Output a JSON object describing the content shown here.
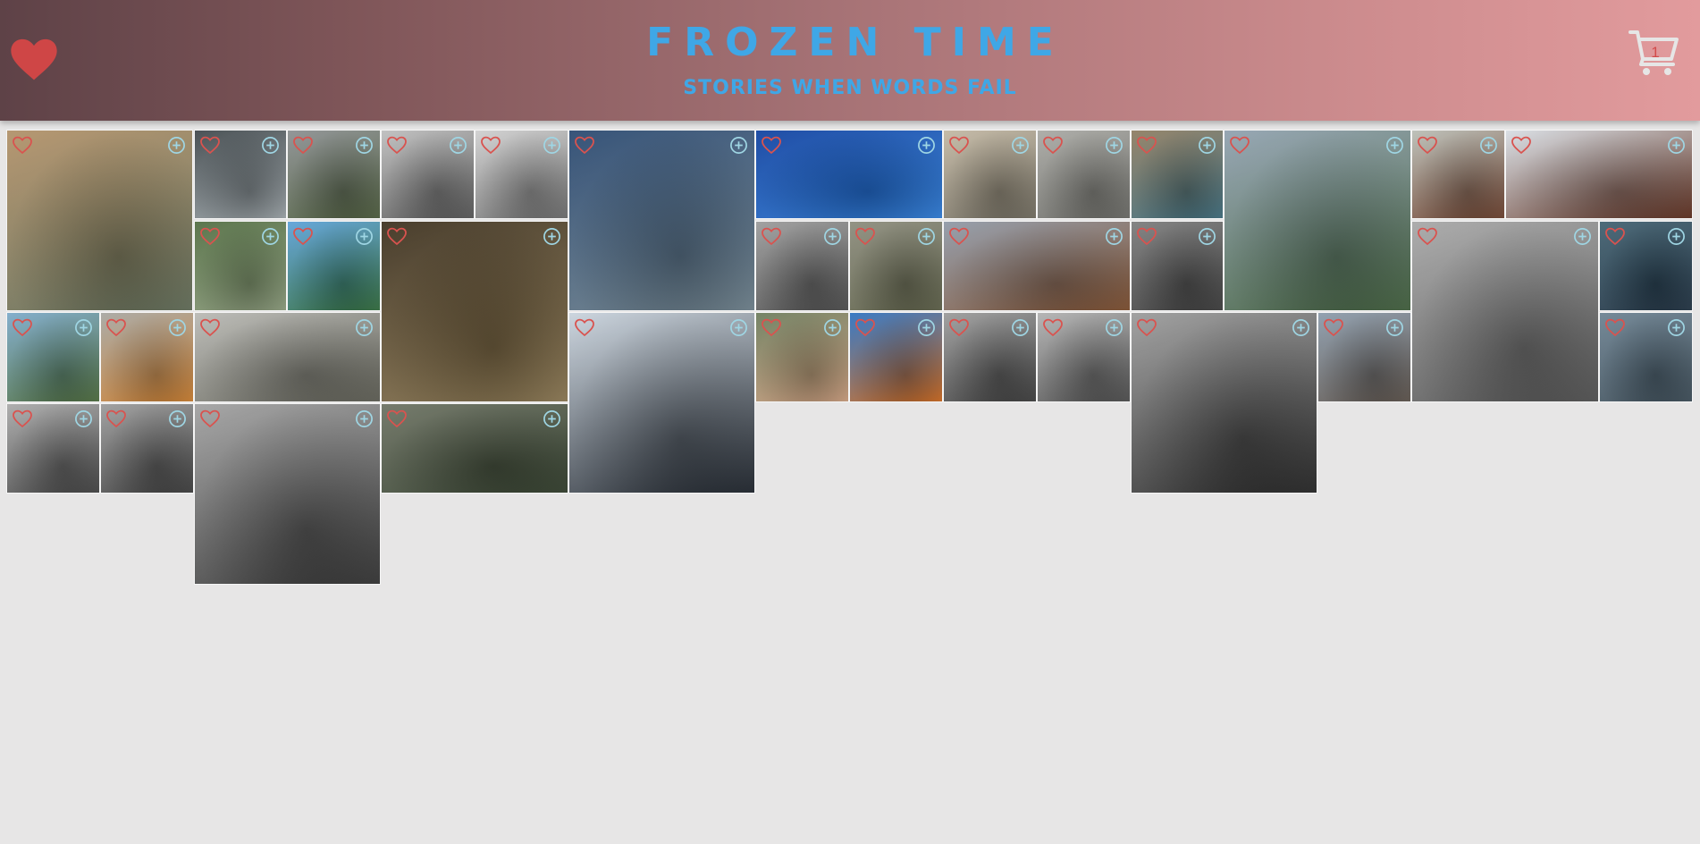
{
  "header": {
    "title": "FROZEN TIME",
    "subtitle": "STORIES WHEN WORDS FAIL",
    "cart_count": "1"
  },
  "colors": {
    "title_blue": "#3fa7e6",
    "heart_red": "#d9534f",
    "add_icon": "#9fd6e4",
    "page_background": "#e7e6e6"
  },
  "icons": {
    "logo": "heart-icon",
    "cart": "shopping-cart-icon",
    "favorite": "heart-outline-icon",
    "add": "plus-circle-icon"
  },
  "photos": [
    {
      "name": "photo-ponte-vecchio",
      "c1": "#b08f66",
      "c2": "#5e6a55"
    },
    {
      "name": "photo-stormy-mountains",
      "c1": "#3c4448",
      "c2": "#9aa2a6"
    },
    {
      "name": "photo-valley-clouds",
      "c1": "#8a8e90",
      "c2": "#4a5a3a"
    },
    {
      "name": "photo-snowy-trees-bw",
      "c1": "#bdbdbd",
      "c2": "#555555"
    },
    {
      "name": "photo-white-horse",
      "c1": "#cfcfcf",
      "c2": "#6b6b6b"
    },
    {
      "name": "photo-blue-house-dam",
      "c1": "#27466e",
      "c2": "#6c7f8a"
    },
    {
      "name": "photo-mountain-lake",
      "c1": "#0d3f9e",
      "c2": "#2b79d4"
    },
    {
      "name": "photo-kids-door",
      "c1": "#c2b7a2",
      "c2": "#6f6a5d"
    },
    {
      "name": "photo-stone-steps",
      "c1": "#a8a8a3",
      "c2": "#686863"
    },
    {
      "name": "photo-rainy-street",
      "c1": "#8d7b5f",
      "c2": "#3b6a7a"
    },
    {
      "name": "photo-cliff-peaks",
      "c1": "#8fa0ae",
      "c2": "#3e5d3a"
    },
    {
      "name": "photo-bird-gliding",
      "c1": "#b9bdb5",
      "c2": "#6a3d2a"
    },
    {
      "name": "photo-red-kite",
      "c1": "#d7dde3",
      "c2": "#5a2a1a"
    },
    {
      "name": "photo-overgrown-car",
      "c1": "#4f6b3f",
      "c2": "#8a9a7a"
    },
    {
      "name": "photo-green-hills",
      "c1": "#5aa0d8",
      "c2": "#2e6a3a"
    },
    {
      "name": "photo-catacomb-skulls",
      "c1": "#3a2e1c",
      "c2": "#8a7650"
    },
    {
      "name": "photo-boat-bw",
      "c1": "#9a9a9a",
      "c2": "#4a4a4a"
    },
    {
      "name": "photo-cemetery-statues",
      "c1": "#8a8a7a",
      "c2": "#5a5d45"
    },
    {
      "name": "photo-spaniel-dog",
      "c1": "#8e98a6",
      "c2": "#7a4a2a"
    },
    {
      "name": "photo-building-entrance",
      "c1": "#7a7a7a",
      "c2": "#3a3a3a"
    },
    {
      "name": "photo-factory-bw",
      "c1": "#a6a6a6",
      "c2": "#4e4e4e"
    },
    {
      "name": "photo-dolphin",
      "c1": "#3e5e6e",
      "c2": "#1e3040"
    },
    {
      "name": "photo-arched-bridge",
      "c1": "#7aa8c8",
      "c2": "#4a6a3a"
    },
    {
      "name": "photo-orange-robe",
      "c1": "#a5a5a0",
      "c2": "#c87a2a"
    },
    {
      "name": "photo-climber-stairs",
      "c1": "#b8b8b3",
      "c2": "#5a5a50"
    },
    {
      "name": "photo-palm-tree",
      "c1": "#c8d2dc",
      "c2": "#1a2028"
    },
    {
      "name": "photo-man-toy-guitar",
      "c1": "#6a7a5a",
      "c2": "#c89a7a"
    },
    {
      "name": "photo-orange-doghouse",
      "c1": "#2a70c0",
      "c2": "#c8641a"
    },
    {
      "name": "photo-stadium-dome",
      "c1": "#9a9a9a",
      "c2": "#3a3a3a"
    },
    {
      "name": "photo-mansion-bw",
      "c1": "#b0b0b0",
      "c2": "#4a4a4a"
    },
    {
      "name": "photo-tower-clouds-bw",
      "c1": "#9a9a9a",
      "c2": "#222222"
    },
    {
      "name": "photo-cathedral",
      "c1": "#8a9aaa",
      "c2": "#5a5048"
    },
    {
      "name": "photo-seal-waves",
      "c1": "#6a8090",
      "c2": "#3a4a55"
    },
    {
      "name": "photo-beach-huts-bw",
      "c1": "#a8a8a8",
      "c2": "#404040"
    },
    {
      "name": "photo-narrow-steps-bw",
      "c1": "#9a9a9a",
      "c2": "#3a3a3a"
    },
    {
      "name": "photo-old-town-street",
      "c1": "#a0a0a0",
      "c2": "#303030"
    },
    {
      "name": "photo-forest-stairs",
      "c1": "#6a7060",
      "c2": "#2e3a28"
    }
  ]
}
